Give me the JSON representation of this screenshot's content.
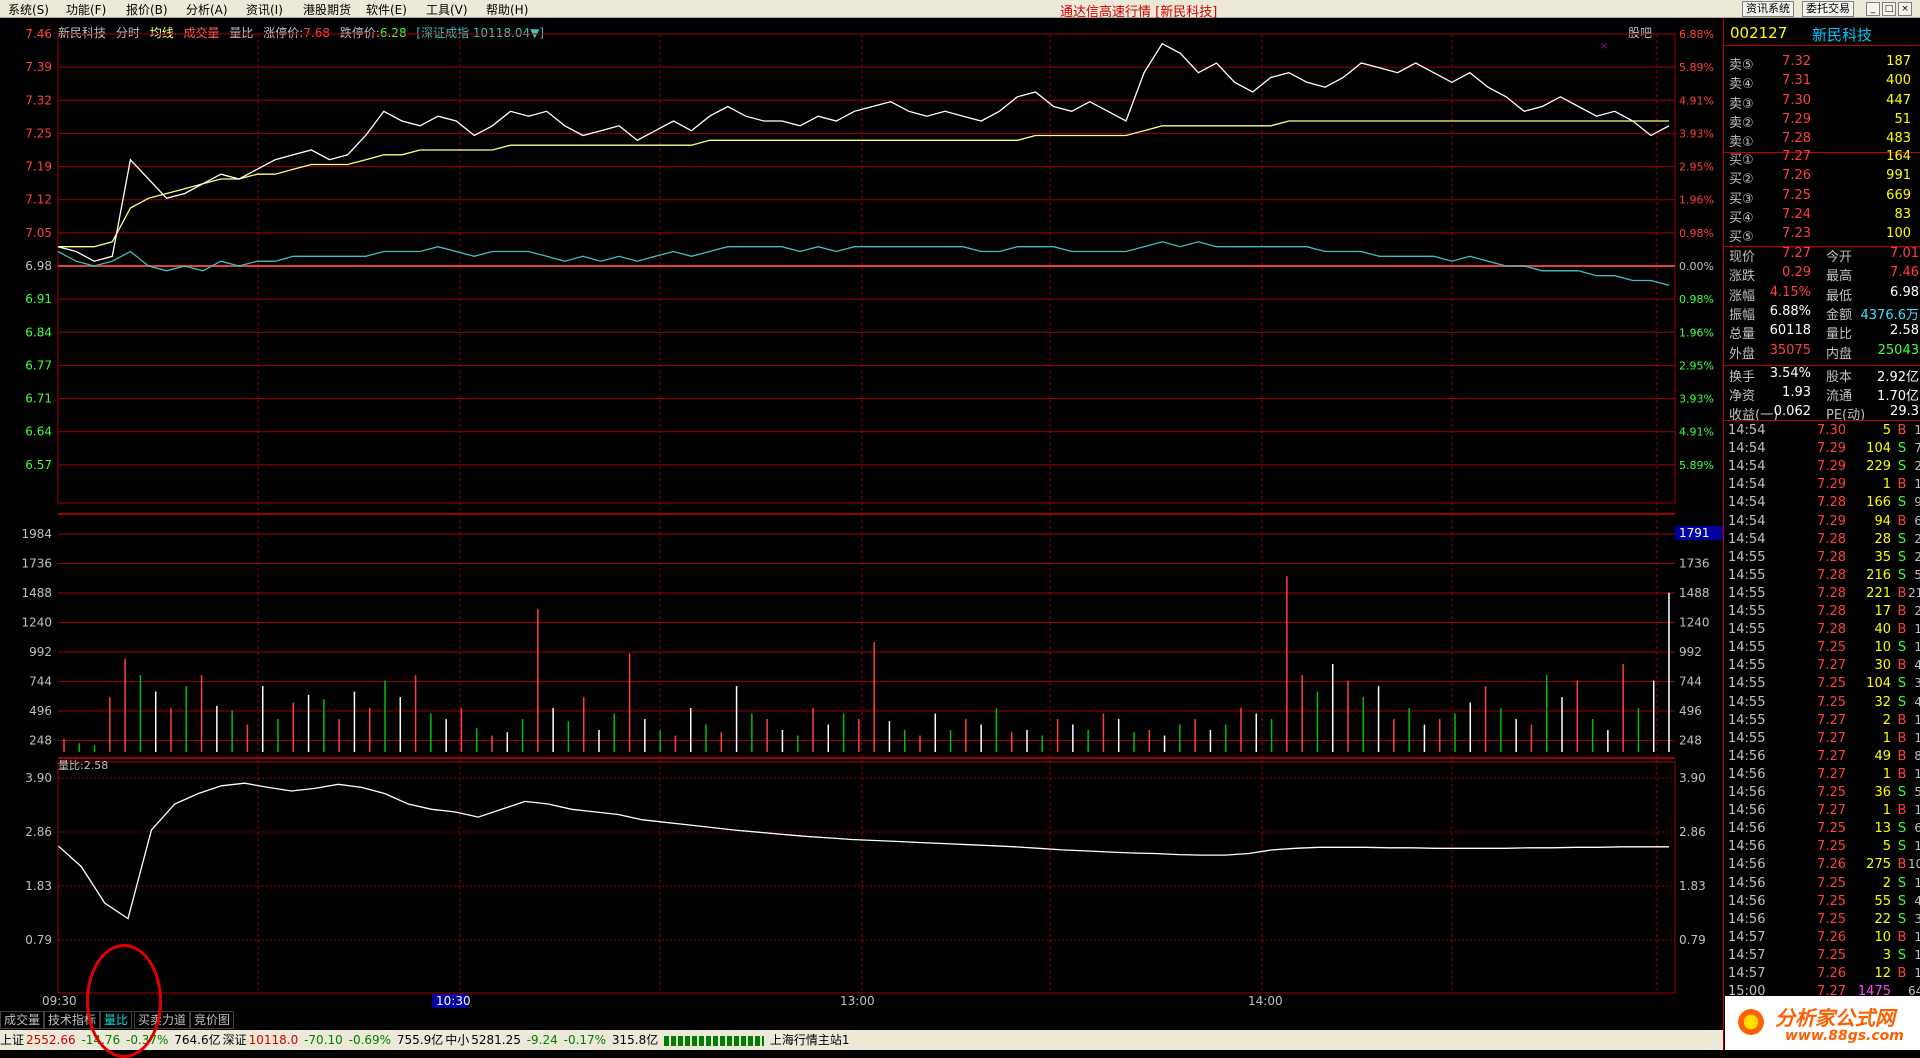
{
  "menu": [
    "系统(S)",
    "功能(F)",
    "报价(B)",
    "分析(A)",
    "资讯(I)",
    "港股期货",
    "软件(E)",
    "工具(V)",
    "帮助(H)"
  ],
  "window_title": "通达信高速行情 [新民科技]",
  "top_buttons": [
    "资讯系统",
    "委托交易"
  ],
  "chart_header": {
    "stock": "新民科技",
    "items": [
      "分时",
      "均线",
      "成交量",
      "量比"
    ],
    "limit_up_label": "涨停价:",
    "limit_up": "7.68",
    "limit_down_label": "跌停价:",
    "limit_down": "6.28",
    "index_label": "[深证成指 10118.04▼]",
    "guba": "股吧"
  },
  "colors": {
    "up": "#ff3030",
    "down": "#00c000",
    "grid": "#a00000",
    "price_line": "#ffffff",
    "avg_line": "#ffff80",
    "index_line": "#40c0c0"
  },
  "chart_data": [
    {
      "type": "line",
      "name": "price",
      "y_ticks_left": [
        "7.46",
        "7.39",
        "7.32",
        "7.25",
        "7.19",
        "7.12",
        "7.05",
        "6.98",
        "6.91",
        "6.84",
        "6.77",
        "6.71",
        "6.64",
        "6.57"
      ],
      "y_ticks_right": [
        "6.88%",
        "5.89%",
        "4.91%",
        "3.93%",
        "2.95%",
        "1.96%",
        "0.98%",
        "0.00%",
        "0.98%",
        "1.96%",
        "2.95%",
        "3.93%",
        "4.91%",
        "5.89%"
      ],
      "ylim": [
        6.5,
        7.46
      ],
      "x_labels": [
        "09:30",
        "10:30",
        "13:00",
        "14:00"
      ],
      "series": [
        {
          "values": [
            7.02,
            7.01,
            6.99,
            7.0,
            7.2,
            7.16,
            7.12,
            7.13,
            7.15,
            7.17,
            7.16,
            7.18,
            7.2,
            7.21,
            7.22,
            7.2,
            7.21,
            7.25,
            7.3,
            7.28,
            7.27,
            7.29,
            7.28,
            7.25,
            7.27,
            7.3,
            7.29,
            7.3,
            7.27,
            7.25,
            7.26,
            7.27,
            7.24,
            7.26,
            7.28,
            7.26,
            7.29,
            7.31,
            7.29,
            7.28,
            7.28,
            7.27,
            7.29,
            7.28,
            7.3,
            7.31,
            7.32,
            7.3,
            7.29,
            7.3,
            7.29,
            7.28,
            7.3,
            7.33,
            7.34,
            7.31,
            7.3,
            7.32,
            7.3,
            7.28,
            7.38,
            7.44,
            7.42,
            7.38,
            7.4,
            7.36,
            7.34,
            7.37,
            7.38,
            7.36,
            7.35,
            7.37,
            7.4,
            7.39,
            7.38,
            7.4,
            7.38,
            7.36,
            7.38,
            7.35,
            7.33,
            7.3,
            7.31,
            7.33,
            7.31,
            7.29,
            7.3,
            7.28,
            7.25,
            7.27
          ]
        },
        {
          "values": [
            7.02,
            7.02,
            7.02,
            7.03,
            7.1,
            7.12,
            7.13,
            7.14,
            7.15,
            7.16,
            7.16,
            7.17,
            7.17,
            7.18,
            7.19,
            7.19,
            7.19,
            7.2,
            7.21,
            7.21,
            7.22,
            7.22,
            7.22,
            7.22,
            7.22,
            7.23,
            7.23,
            7.23,
            7.23,
            7.23,
            7.23,
            7.23,
            7.23,
            7.23,
            7.23,
            7.23,
            7.24,
            7.24,
            7.24,
            7.24,
            7.24,
            7.24,
            7.24,
            7.24,
            7.24,
            7.24,
            7.24,
            7.24,
            7.24,
            7.24,
            7.24,
            7.24,
            7.24,
            7.24,
            7.25,
            7.25,
            7.25,
            7.25,
            7.25,
            7.25,
            7.26,
            7.27,
            7.27,
            7.27,
            7.27,
            7.27,
            7.27,
            7.27,
            7.28,
            7.28,
            7.28,
            7.28,
            7.28,
            7.28,
            7.28,
            7.28,
            7.28,
            7.28,
            7.28,
            7.28,
            7.28,
            7.28,
            7.28,
            7.28,
            7.28,
            7.28,
            7.28,
            7.28,
            7.28,
            7.28
          ]
        },
        {
          "values": [
            7.01,
            6.99,
            6.98,
            6.99,
            7.01,
            6.98,
            6.97,
            6.98,
            6.97,
            6.99,
            6.98,
            6.99,
            6.99,
            7.0,
            7.0,
            7.0,
            7.0,
            7.0,
            7.01,
            7.01,
            7.01,
            7.02,
            7.01,
            7.0,
            7.01,
            7.01,
            7.01,
            7.0,
            6.99,
            7.0,
            6.99,
            7.0,
            6.99,
            7.0,
            7.01,
            7.0,
            7.01,
            7.02,
            7.02,
            7.02,
            7.02,
            7.01,
            7.02,
            7.01,
            7.02,
            7.02,
            7.02,
            7.02,
            7.02,
            7.02,
            7.02,
            7.01,
            7.01,
            7.02,
            7.02,
            7.02,
            7.01,
            7.01,
            7.01,
            7.01,
            7.02,
            7.03,
            7.02,
            7.03,
            7.02,
            7.02,
            7.02,
            7.02,
            7.02,
            7.02,
            7.01,
            7.01,
            7.01,
            7.0,
            7.0,
            7.0,
            7.0,
            6.99,
            7.0,
            6.99,
            6.98,
            6.98,
            6.97,
            6.97,
            6.97,
            6.96,
            6.96,
            6.95,
            6.95,
            6.94
          ]
        }
      ]
    },
    {
      "type": "bar",
      "name": "volume",
      "y_ticks": [
        "1984",
        "1736",
        "1488",
        "1240",
        "992",
        "744",
        "496",
        "248"
      ],
      "ylim": [
        0,
        1984
      ],
      "current_marker": "1791",
      "values": [
        120,
        80,
        60,
        500,
        850,
        700,
        550,
        400,
        600,
        700,
        420,
        380,
        250,
        600,
        300,
        450,
        520,
        480,
        300,
        550,
        400,
        650,
        500,
        700,
        350,
        300,
        400,
        220,
        150,
        180,
        300,
        1300,
        400,
        280,
        500,
        200,
        350,
        900,
        300,
        200,
        150,
        400,
        250,
        180,
        600,
        350,
        300,
        200,
        150,
        400,
        250,
        350,
        300,
        1000,
        280,
        200,
        150,
        350,
        200,
        300,
        250,
        400,
        180,
        200,
        150,
        300,
        250,
        200,
        350,
        300,
        180,
        200,
        150,
        250,
        300,
        200,
        250,
        400,
        350,
        300,
        1600,
        700,
        550,
        800,
        650,
        500,
        600,
        300,
        400,
        250,
        300,
        350,
        450,
        600,
        400,
        300,
        250,
        700,
        500,
        650,
        300,
        200,
        800,
        400,
        650,
        1450
      ],
      "colors": [
        "u",
        "d",
        "d",
        "u",
        "u",
        "d",
        "w",
        "u",
        "d",
        "u",
        "w",
        "d",
        "u",
        "w",
        "d",
        "u",
        "w",
        "d",
        "u",
        "w",
        "u",
        "d",
        "w",
        "u",
        "d",
        "w",
        "u",
        "d",
        "u",
        "w",
        "d",
        "u",
        "w",
        "d",
        "u",
        "w",
        "d",
        "u",
        "w",
        "d",
        "u",
        "w",
        "d",
        "u",
        "w",
        "d",
        "u",
        "w",
        "d",
        "u",
        "w",
        "d",
        "u",
        "u",
        "w",
        "d",
        "u",
        "w",
        "d",
        "u",
        "w",
        "d",
        "u",
        "w",
        "d",
        "u",
        "w",
        "d",
        "u",
        "w",
        "d",
        "u",
        "w",
        "d",
        "u",
        "w",
        "d",
        "u",
        "w",
        "d",
        "u",
        "u",
        "d",
        "w",
        "u",
        "d",
        "w",
        "u",
        "d",
        "w",
        "u",
        "d",
        "w",
        "u",
        "d",
        "w",
        "u",
        "d",
        "w",
        "u",
        "d",
        "w",
        "u",
        "d",
        "w",
        "w"
      ]
    },
    {
      "type": "line",
      "name": "量比",
      "label": "量比:2.58",
      "y_ticks": [
        "3.90",
        "2.86",
        "1.83",
        "0.79"
      ],
      "ylim": [
        0,
        4.3
      ],
      "values": [
        2.6,
        2.2,
        1.5,
        1.2,
        2.9,
        3.4,
        3.6,
        3.75,
        3.8,
        3.72,
        3.65,
        3.7,
        3.78,
        3.72,
        3.6,
        3.4,
        3.3,
        3.25,
        3.15,
        3.3,
        3.45,
        3.4,
        3.3,
        3.25,
        3.2,
        3.1,
        3.05,
        3.0,
        2.95,
        2.9,
        2.86,
        2.82,
        2.78,
        2.75,
        2.72,
        2.7,
        2.68,
        2.66,
        2.64,
        2.62,
        2.6,
        2.58,
        2.55,
        2.52,
        2.5,
        2.48,
        2.46,
        2.45,
        2.43,
        2.42,
        2.42,
        2.45,
        2.52,
        2.55,
        2.57,
        2.57,
        2.57,
        2.56,
        2.56,
        2.55,
        2.55,
        2.55,
        2.55,
        2.56,
        2.56,
        2.57,
        2.57,
        2.58,
        2.58,
        2.58
      ]
    }
  ],
  "volratio_label": "量比:2.58",
  "bottom_tabs": [
    "成交量",
    "技术指标",
    "量比",
    "买卖力道",
    "竞价图"
  ],
  "status_bar": [
    {
      "label": "上证",
      "value": "2552.66",
      "chg": "-14.76",
      "pct": "-0.37%",
      "amt": "764.6亿"
    },
    {
      "label": "深证",
      "value": "10118.0",
      "chg": "-70.10",
      "pct": "-0.69%",
      "amt": "755.9亿"
    },
    {
      "label": "中小",
      "value": "5281.25",
      "chg": "-9.24",
      "pct": "-0.17%",
      "amt": "315.8亿"
    }
  ],
  "status_station": "上海行情主站1",
  "right_panel": {
    "code": "002127",
    "name": "新民科技",
    "sell": [
      {
        "label": "卖⑤",
        "price": "7.32",
        "vol": "187"
      },
      {
        "label": "卖④",
        "price": "7.31",
        "vol": "400"
      },
      {
        "label": "卖③",
        "price": "7.30",
        "vol": "447"
      },
      {
        "label": "卖②",
        "price": "7.29",
        "vol": "51"
      },
      {
        "label": "卖①",
        "price": "7.28",
        "vol": "483"
      }
    ],
    "buy": [
      {
        "label": "买①",
        "price": "7.27",
        "vol": "164"
      },
      {
        "label": "买②",
        "price": "7.26",
        "vol": "991"
      },
      {
        "label": "买③",
        "price": "7.25",
        "vol": "669"
      },
      {
        "label": "买④",
        "price": "7.24",
        "vol": "83"
      },
      {
        "label": "买⑤",
        "price": "7.23",
        "vol": "100"
      }
    ],
    "quote": [
      {
        "l1": "现价",
        "v1": "7.27",
        "l2": "今开",
        "v2": "7.01",
        "c1": "up",
        "c2": "up"
      },
      {
        "l1": "涨跌",
        "v1": "0.29",
        "l2": "最高",
        "v2": "7.46",
        "c1": "up",
        "c2": "up"
      },
      {
        "l1": "涨幅",
        "v1": "4.15%",
        "l2": "最低",
        "v2": "6.98",
        "c1": "up",
        "c2": "w"
      },
      {
        "l1": "振幅",
        "v1": "6.88%",
        "l2": "金额",
        "v2": "4376.6万",
        "c1": "w",
        "c2": "cy"
      },
      {
        "l1": "总量",
        "v1": "60118",
        "l2": "量比",
        "v2": "2.58",
        "c1": "w",
        "c2": "w"
      },
      {
        "l1": "外盘",
        "v1": "35075",
        "l2": "内盘",
        "v2": "25043",
        "c1": "up",
        "c2": "dn"
      },
      {
        "l1": "换手",
        "v1": "3.54%",
        "l2": "股本",
        "v2": "2.92亿",
        "c1": "w",
        "c2": "w"
      },
      {
        "l1": "净资",
        "v1": "1.93",
        "l2": "流通",
        "v2": "1.70亿",
        "c1": "w",
        "c2": "w"
      },
      {
        "l1": "收益(一)",
        "v1": "0.062",
        "l2": "PE(动)",
        "v2": "29.3",
        "c1": "w",
        "c2": "w"
      }
    ],
    "ticks": [
      {
        "t": "14:54",
        "p": "7.30",
        "v": "5",
        "d": "B",
        "n": "1"
      },
      {
        "t": "14:54",
        "p": "7.29",
        "v": "104",
        "d": "S",
        "n": "7"
      },
      {
        "t": "14:54",
        "p": "7.29",
        "v": "229",
        "d": "S",
        "n": "2"
      },
      {
        "t": "14:54",
        "p": "7.29",
        "v": "1",
        "d": "B",
        "n": "1"
      },
      {
        "t": "14:54",
        "p": "7.28",
        "v": "166",
        "d": "S",
        "n": "9"
      },
      {
        "t": "14:54",
        "p": "7.29",
        "v": "94",
        "d": "B",
        "n": "6"
      },
      {
        "t": "14:54",
        "p": "7.28",
        "v": "28",
        "d": "S",
        "n": "2"
      },
      {
        "t": "14:55",
        "p": "7.28",
        "v": "35",
        "d": "S",
        "n": "2"
      },
      {
        "t": "14:55",
        "p": "7.28",
        "v": "216",
        "d": "S",
        "n": "5"
      },
      {
        "t": "14:55",
        "p": "7.28",
        "v": "221",
        "d": "B",
        "n": "21"
      },
      {
        "t": "14:55",
        "p": "7.28",
        "v": "17",
        "d": "B",
        "n": "2"
      },
      {
        "t": "14:55",
        "p": "7.28",
        "v": "40",
        "d": "B",
        "n": "1"
      },
      {
        "t": "14:55",
        "p": "7.25",
        "v": "10",
        "d": "S",
        "n": "1"
      },
      {
        "t": "14:55",
        "p": "7.27",
        "v": "30",
        "d": "B",
        "n": "4"
      },
      {
        "t": "14:55",
        "p": "7.25",
        "v": "104",
        "d": "S",
        "n": "3"
      },
      {
        "t": "14:55",
        "p": "7.25",
        "v": "32",
        "d": "S",
        "n": "4"
      },
      {
        "t": "14:55",
        "p": "7.27",
        "v": "2",
        "d": "B",
        "n": "1"
      },
      {
        "t": "14:55",
        "p": "7.27",
        "v": "1",
        "d": "B",
        "n": "1"
      },
      {
        "t": "14:56",
        "p": "7.27",
        "v": "49",
        "d": "B",
        "n": "8"
      },
      {
        "t": "14:56",
        "p": "7.27",
        "v": "1",
        "d": "B",
        "n": "1"
      },
      {
        "t": "14:56",
        "p": "7.25",
        "v": "36",
        "d": "S",
        "n": "5"
      },
      {
        "t": "14:56",
        "p": "7.27",
        "v": "1",
        "d": "B",
        "n": "1"
      },
      {
        "t": "14:56",
        "p": "7.25",
        "v": "13",
        "d": "S",
        "n": "6"
      },
      {
        "t": "14:56",
        "p": "7.25",
        "v": "5",
        "d": "S",
        "n": "1"
      },
      {
        "t": "14:56",
        "p": "7.26",
        "v": "275",
        "d": "B",
        "n": "10"
      },
      {
        "t": "14:56",
        "p": "7.25",
        "v": "2",
        "d": "S",
        "n": "1"
      },
      {
        "t": "14:56",
        "p": "7.25",
        "v": "55",
        "d": "S",
        "n": "4"
      },
      {
        "t": "14:56",
        "p": "7.25",
        "v": "22",
        "d": "S",
        "n": "3"
      },
      {
        "t": "14:57",
        "p": "7.26",
        "v": "10",
        "d": "B",
        "n": "1"
      },
      {
        "t": "14:57",
        "p": "7.25",
        "v": "3",
        "d": "S",
        "n": "1"
      },
      {
        "t": "14:57",
        "p": "7.26",
        "v": "12",
        "d": "B",
        "n": "1"
      },
      {
        "t": "15:00",
        "p": "7.27",
        "v": "1475",
        "d": "",
        "n": "64"
      }
    ]
  },
  "logo": {
    "l1": "分析家公式网",
    "l2": "www.88gs.com"
  }
}
